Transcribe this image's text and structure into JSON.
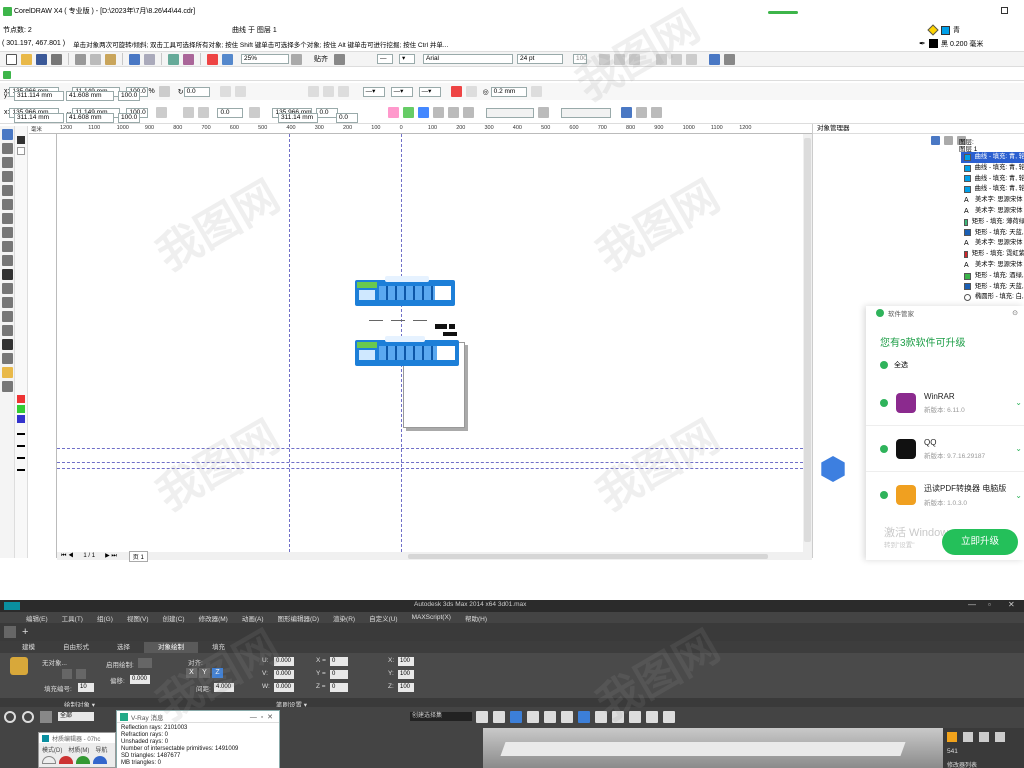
{
  "titlebar": {
    "title": "CorelDRAW X4 ( 专业版 ) - [D:\\2023年\\7月\\8.26\\44\\44.cdr]"
  },
  "statusbar_top": {
    "nodes": "节点数: 2",
    "object": "曲线 于 图层 1",
    "fill_name": "青",
    "outline": "黑  0.200 毫米"
  },
  "hint": {
    "coords": "( 301.197, 467.801 )",
    "message": "单击对象两次可旋转/倾斜; 双击工具可选择所有对象; 按住 Shift 键单击可选择多个对象; 按住 Alt 键单击可进行挖掘; 按住 Ctrl 并单..."
  },
  "standard_bar": {
    "zoom": "25%",
    "snap": "贴齐",
    "font": "Arial",
    "font_size": "24 pt",
    "zoom_100": "100"
  },
  "property_bar1": {
    "x": "135.966 mm",
    "y": "311.114 mm",
    "w": "11.149 mm",
    "h": "41.608 mm",
    "sx": "100.0",
    "sy": "100.0",
    "pct": "%",
    "angle": "0.0",
    "outline_w": "0.2 mm"
  },
  "property_bar2": {
    "x": "135.966 mm",
    "y": "311.14 mm",
    "w": "11.149 mm",
    "h": "41.608 mm",
    "sx": "100.0",
    "sy": "100.0",
    "angle": "0.0",
    "x2": "135.966 mm",
    "y2": "311.14 mm",
    "v1": "0.0",
    "v2": "0.0"
  },
  "ruler": {
    "ticks": [
      "1200",
      "1100",
      "1000",
      "900",
      "800",
      "700",
      "600",
      "500",
      "400",
      "300",
      "200",
      "100",
      "0",
      "100",
      "200",
      "300",
      "400",
      "500",
      "600",
      "700",
      "800",
      "900",
      "1000",
      "1100",
      "1200"
    ],
    "unit": "毫米"
  },
  "page_nav": {
    "pages": "1 / 1",
    "tab": "页 1"
  },
  "object_manager": {
    "title": "对象管理器",
    "layer_header": "图层:",
    "layer_name": "图层 1",
    "items": [
      {
        "label": "曲线 - 填充: 青, 轮",
        "color": "#00a0e9",
        "kind": "curve",
        "selected": true
      },
      {
        "label": "曲线 - 填充: 青, 轮",
        "color": "#00a0e9",
        "kind": "curve",
        "selected": false
      },
      {
        "label": "曲线 - 填充: 青, 轮",
        "color": "#00a0e9",
        "kind": "curve",
        "selected": false
      },
      {
        "label": "曲线 - 填充: 青, 轮",
        "color": "#00a0e9",
        "kind": "curve",
        "selected": false
      },
      {
        "label": "美术字: 思源宋体",
        "color": "#333333",
        "kind": "text",
        "selected": false
      },
      {
        "label": "美术字: 思源宋体",
        "color": "#333333",
        "kind": "text",
        "selected": false
      },
      {
        "label": "矩形 - 填充: 薄荷绿",
        "color": "#3cb878",
        "kind": "rect",
        "selected": false
      },
      {
        "label": "矩形 - 填充: 天蓝,",
        "color": "#1a5fb4",
        "kind": "rect",
        "selected": false
      },
      {
        "label": "美术字: 思源宋体",
        "color": "#333333",
        "kind": "text",
        "selected": false
      },
      {
        "label": "矩形 - 填充: 霓虹紫",
        "color": "#d3262a",
        "kind": "rect",
        "selected": false
      },
      {
        "label": "美术字: 思源宋体",
        "color": "#333333",
        "kind": "text",
        "selected": false
      },
      {
        "label": "矩形 - 填充: 酒绿,",
        "color": "#3bb44a",
        "kind": "rect",
        "selected": false
      },
      {
        "label": "矩形 - 填充: 天蓝,",
        "color": "#1a5fb4",
        "kind": "rect",
        "selected": false
      },
      {
        "label": "椭圆形 - 填充: 白,",
        "color": "#ffffff",
        "kind": "ellipse",
        "selected": false
      }
    ]
  },
  "popup": {
    "title": "软件管家",
    "headline": "您有3款软件可升级",
    "select_all": "全选",
    "apps": [
      {
        "name": "WinRAR",
        "version": "新版本: 6.11.0",
        "icon": "winrar-icon"
      },
      {
        "name": "QQ",
        "version": "新版本: 9.7.16.29187",
        "icon": "qq-icon"
      },
      {
        "name": "迅读PDF转换器 电脑版",
        "version": "新版本: 1.0.3.0",
        "icon": "pdf-converter-icon"
      }
    ],
    "activate": "激活 Windows",
    "activate_sub": "转到\"设置\"",
    "upgrade_button": "立即升级"
  },
  "max": {
    "title": "Autodesk 3ds Max 2014 x64     3d01.max",
    "menu": [
      "编辑(E)",
      "工具(T)",
      "组(G)",
      "视图(V)",
      "创建(C)",
      "修改器(M)",
      "动画(A)",
      "图形编辑器(D)",
      "渲染(R)",
      "自定义(U)",
      "MAXScript(X)",
      "帮助(H)"
    ],
    "ribbon_tabs": [
      "建模",
      "自由形式",
      "选择",
      "对象绘制",
      "填充"
    ],
    "active_tab": "对象绘制",
    "paint": {
      "no_object": "无对象...",
      "fill_number": "填充编号:",
      "fill_number_val": "10",
      "enable": "启用绘制:",
      "offset": "偏移:",
      "offset_val": "0.000",
      "align": "对齐:",
      "spacing": "间距:",
      "spacing_val": "4.000",
      "u": "U:",
      "v": "V:",
      "w": "W:",
      "u_val": "0.000",
      "v_val": "0.000",
      "w_val": "0.000",
      "x": "X =",
      "y": "Y =",
      "z": "Z =",
      "x_val": "0",
      "y_val": "0",
      "z_val": "0",
      "sx": "X:",
      "sy": "Y:",
      "sz": "Z:",
      "sx_val": "100",
      "sy_val": "100",
      "sz_val": "100",
      "xyz": [
        "X",
        "Y",
        "Z"
      ]
    },
    "footer": [
      "绘制对象 ▾",
      "笔刷设置 ▾"
    ],
    "selection": "全部",
    "named_set": "创建选择集",
    "vray": {
      "title": "V-Ray 消息",
      "lines": [
        "Reflection rays: 2101003",
        "Refraction rays: 0",
        "Unshaded rays: 0",
        "Number of intersectable primitives: 1491009",
        "SD triangles: 1487677",
        "MB triangles: 0"
      ]
    },
    "material": {
      "title": "材质编辑器 - 07hc",
      "menu": [
        "模式(D)",
        "材质(M)",
        "导航"
      ]
    },
    "right_panel": {
      "label": "541",
      "sub": "修改器列表"
    }
  }
}
